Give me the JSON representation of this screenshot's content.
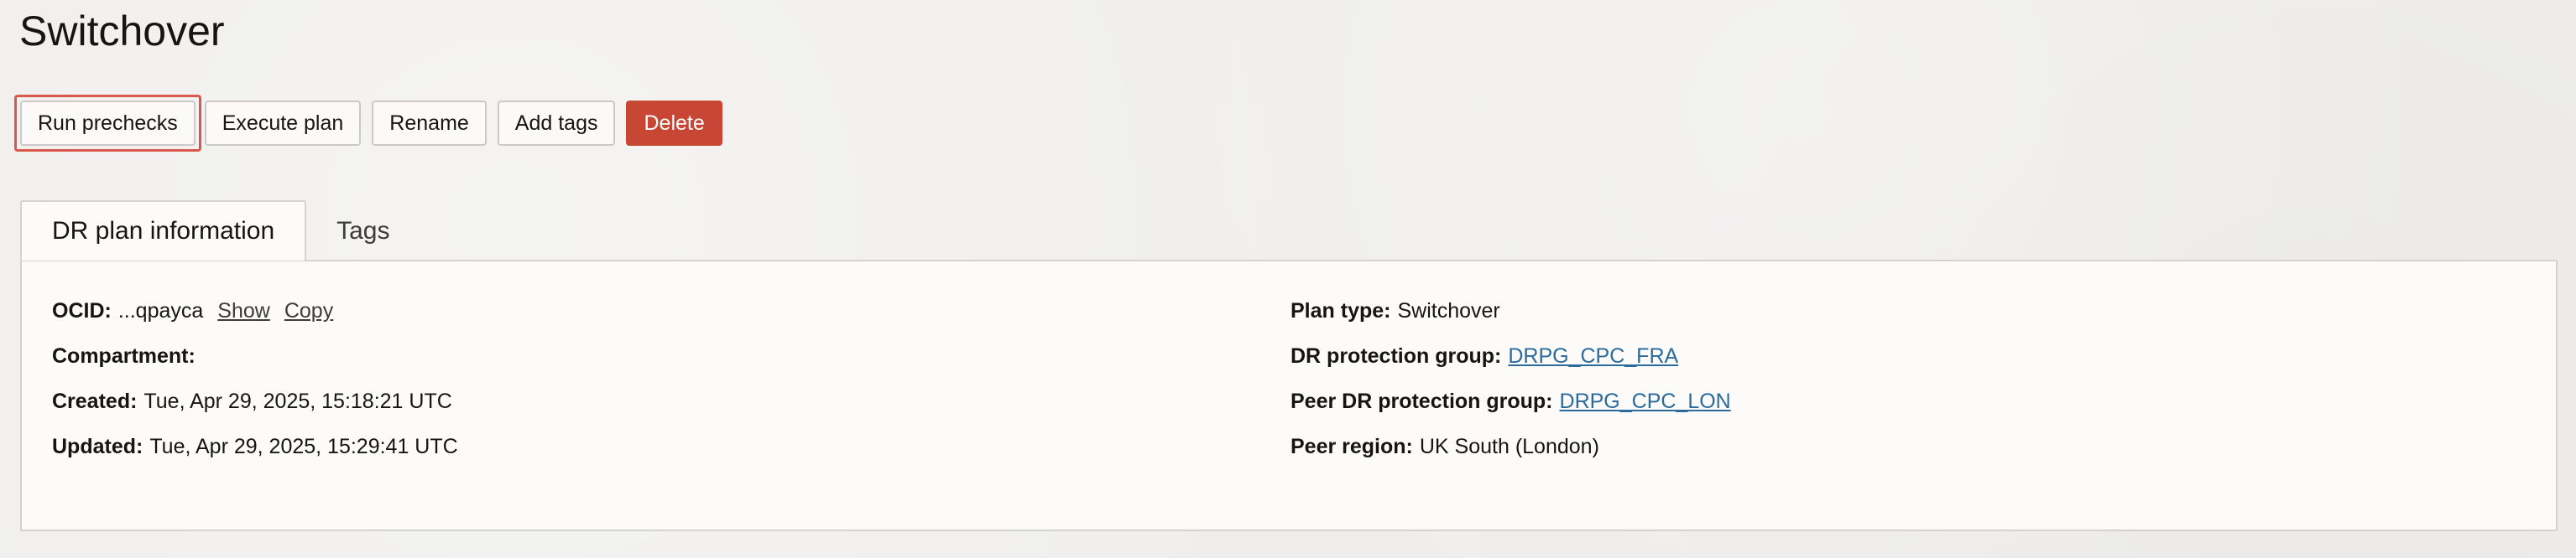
{
  "page": {
    "title": "Switchover"
  },
  "toolbar": {
    "run_prechecks_label": "Run prechecks",
    "execute_plan_label": "Execute plan",
    "rename_label": "Rename",
    "add_tags_label": "Add tags",
    "delete_label": "Delete",
    "highlight_color": "#d9574b",
    "danger_color": "#c74634"
  },
  "tabs": [
    {
      "label": "DR plan information",
      "active": true
    },
    {
      "label": "Tags",
      "active": false
    }
  ],
  "details": {
    "left": {
      "ocid": {
        "label": "OCID:",
        "value": "...qpayca",
        "show_label": "Show",
        "copy_label": "Copy"
      },
      "compartment": {
        "label": "Compartment:",
        "value": ""
      },
      "created": {
        "label": "Created:",
        "value": "Tue, Apr 29, 2025, 15:18:21 UTC"
      },
      "updated": {
        "label": "Updated:",
        "value": "Tue, Apr 29, 2025, 15:29:41 UTC"
      }
    },
    "right": {
      "plan_type": {
        "label": "Plan type:",
        "value": "Switchover"
      },
      "dr_protection_group": {
        "label": "DR protection group:",
        "value": "DRPG_CPC_FRA"
      },
      "peer_dr_protection_group": {
        "label": "Peer DR protection group:",
        "value": "DRPG_CPC_LON"
      },
      "peer_region": {
        "label": "Peer region:",
        "value": "UK South (London)"
      }
    },
    "link_color": "#2b6a9c"
  }
}
